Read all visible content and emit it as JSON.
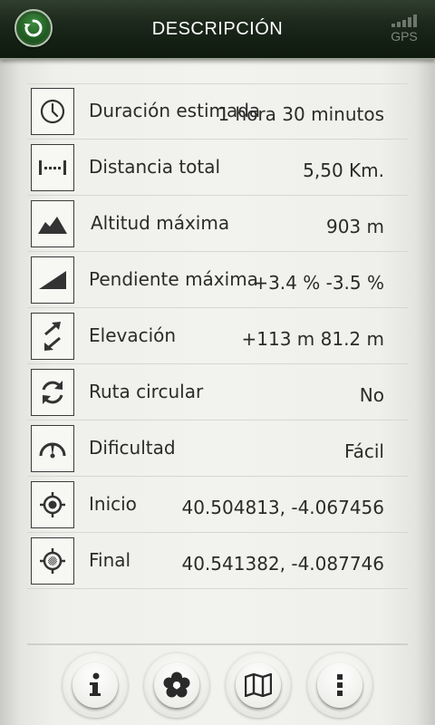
{
  "header": {
    "title": "DESCRIPCIÓN",
    "back_icon": "back-arrow-icon",
    "gps_label": "GPS"
  },
  "rows": [
    {
      "icon": "clock-icon",
      "label": "Duración estimada",
      "value": "1 hora 30 minutos"
    },
    {
      "icon": "distance-icon",
      "label": "Distancia total",
      "value": "5,50 Km."
    },
    {
      "icon": "mountain-icon",
      "label": "Altitud máxima",
      "value": "903 m"
    },
    {
      "icon": "slope-icon",
      "label": "Pendiente máxima",
      "value": "+3.4 %  -3.5 %"
    },
    {
      "icon": "elevation-arrows-icon",
      "label": "Elevación",
      "value": "+113 m  81.2 m"
    },
    {
      "icon": "refresh-icon",
      "label": "Ruta circular",
      "value": "No"
    },
    {
      "icon": "gauge-icon",
      "label": "Dificultad",
      "value": "Fácil"
    },
    {
      "icon": "start-target-icon",
      "label": "Inicio",
      "value": "40.504813, -4.067456"
    },
    {
      "icon": "end-target-icon",
      "label": "Final",
      "value": "40.541382, -4.087746"
    }
  ],
  "toolbar": {
    "buttons": [
      "info-icon",
      "flower-icon",
      "map-icon",
      "more-vertical-icon"
    ]
  },
  "colors": {
    "header_green": "#142013",
    "back_button_green": "#1f5a20",
    "text": "#2b2b2b"
  }
}
